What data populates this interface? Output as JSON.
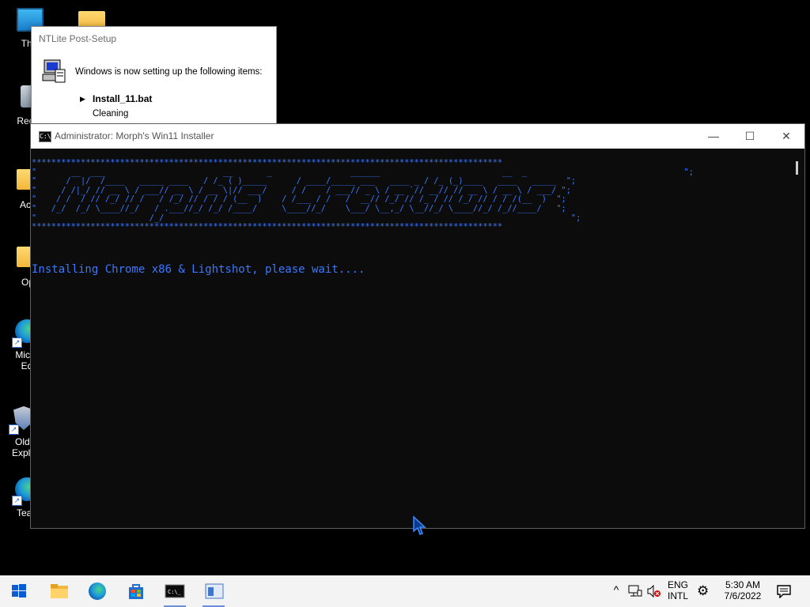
{
  "desktop": {
    "icons": [
      {
        "label": "This",
        "icon": "monitor-icon"
      },
      {
        "label": "Recyc",
        "icon": "recycle-bin-icon"
      },
      {
        "label": "Activ",
        "icon": "folder-icon"
      },
      {
        "label": "Opti",
        "icon": "folder-icon"
      },
      {
        "label": "Micro\nEd",
        "icon": "edge-icon"
      },
      {
        "label": "OldI\nExplo",
        "icon": "shield-icon"
      },
      {
        "label": "Tean",
        "icon": "edge-icon"
      }
    ]
  },
  "ntlite": {
    "title": "NTLite Post-Setup",
    "message": "Windows is now setting up the following items:",
    "bullet": "▶",
    "item": "Install_11.bat",
    "status": "Cleaning"
  },
  "console": {
    "title": "Administrator:  Morph's Win11 Installer",
    "cmd_icon": "C:\\",
    "controls": {
      "minimize": "—",
      "maximize": "☐",
      "close": "✕"
    },
    "ascii_art": "************************************************************************************************\n\"       __  ___                        __       _                ______                         __  _                                \";\n\"      /  |/  /____   _____ ____   / /_ ( )_____      / ____/_____ ___   ____ _ / /_ (_)____   ____   _____  \";\n\"     / /|_/ // __ \\ / ___// __ \\ / __ \\|// ___/     / /    / ___// _ \\ / __ `// __// // __ \\ / __ \\ / ___/ \";\n\"    / /  / // /_/ // /   / /_/ // / / / (__  )    / /___ / /   /  __// /_/ // /_ / // /_/ // / / /(__  )  \";\n\"   /_/  /_/ \\____//_/   / .___//_/ /_/ /____/     \\____//_/    \\___/ \\__,_/ \\__//_/ \\____//_/ /_//____/   \";\n\"                       /_/                                                                                   \";\n************************************************************************************************",
    "status_line": "Installing Chrome x86 & Lightshot, please wait...."
  },
  "taskbar": {
    "apps": [
      {
        "name": "start",
        "icon": "windows-logo-icon"
      },
      {
        "name": "file-explorer",
        "icon": "folder-icon"
      },
      {
        "name": "edge",
        "icon": "edge-icon"
      },
      {
        "name": "store",
        "icon": "store-icon"
      },
      {
        "name": "terminal",
        "icon": "cmd-icon"
      },
      {
        "name": "ntlite",
        "icon": "window-icon"
      }
    ],
    "tray": {
      "lang1": "ENG",
      "lang2": "INTL",
      "time": "5:30 AM",
      "date": "7/6/2022"
    }
  }
}
